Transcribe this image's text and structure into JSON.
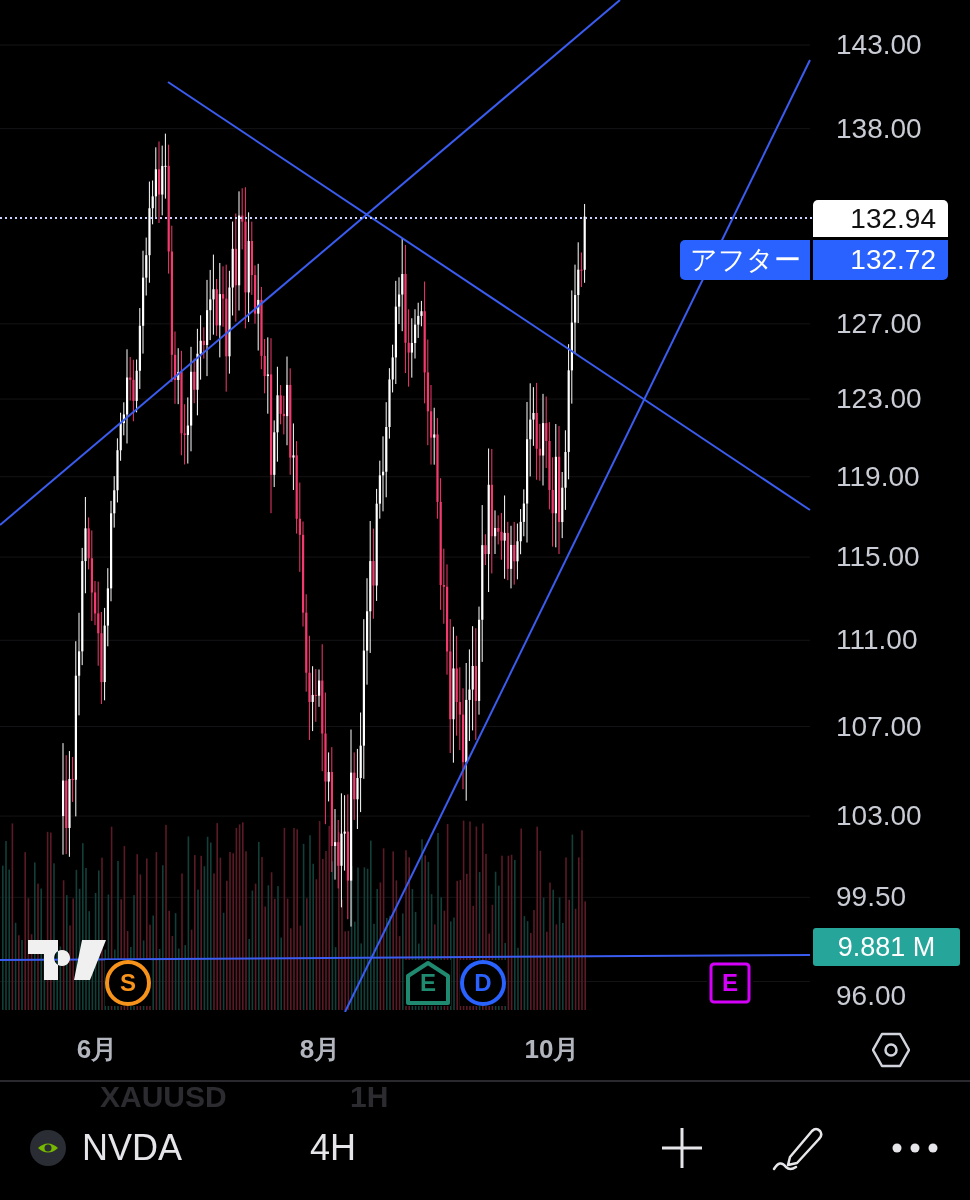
{
  "chart": {
    "price_axis": [
      "143.00",
      "138.00",
      "127.00",
      "123.00",
      "119.00",
      "115.00",
      "111.00",
      "107.00",
      "103.00",
      "99.50",
      "96.00"
    ],
    "last_price": "132.94",
    "after_hours": {
      "label": "アフター",
      "price": "132.72"
    },
    "volume_badge": "9.881 M",
    "events": [
      {
        "letter": "S",
        "kind": "circle",
        "color": "#f7931a"
      },
      {
        "letter": "E",
        "kind": "house",
        "color": "#1f8a70"
      },
      {
        "letter": "D",
        "kind": "circle",
        "color": "#2962ff"
      },
      {
        "letter": "E",
        "kind": "square",
        "color": "#d500f9"
      }
    ],
    "time_axis": [
      "6月",
      "8月",
      "10月"
    ]
  },
  "background_row": {
    "symbol": "XAUUSD",
    "interval": "1H"
  },
  "toolbar": {
    "symbol": "NVDA",
    "interval": "4H"
  }
}
